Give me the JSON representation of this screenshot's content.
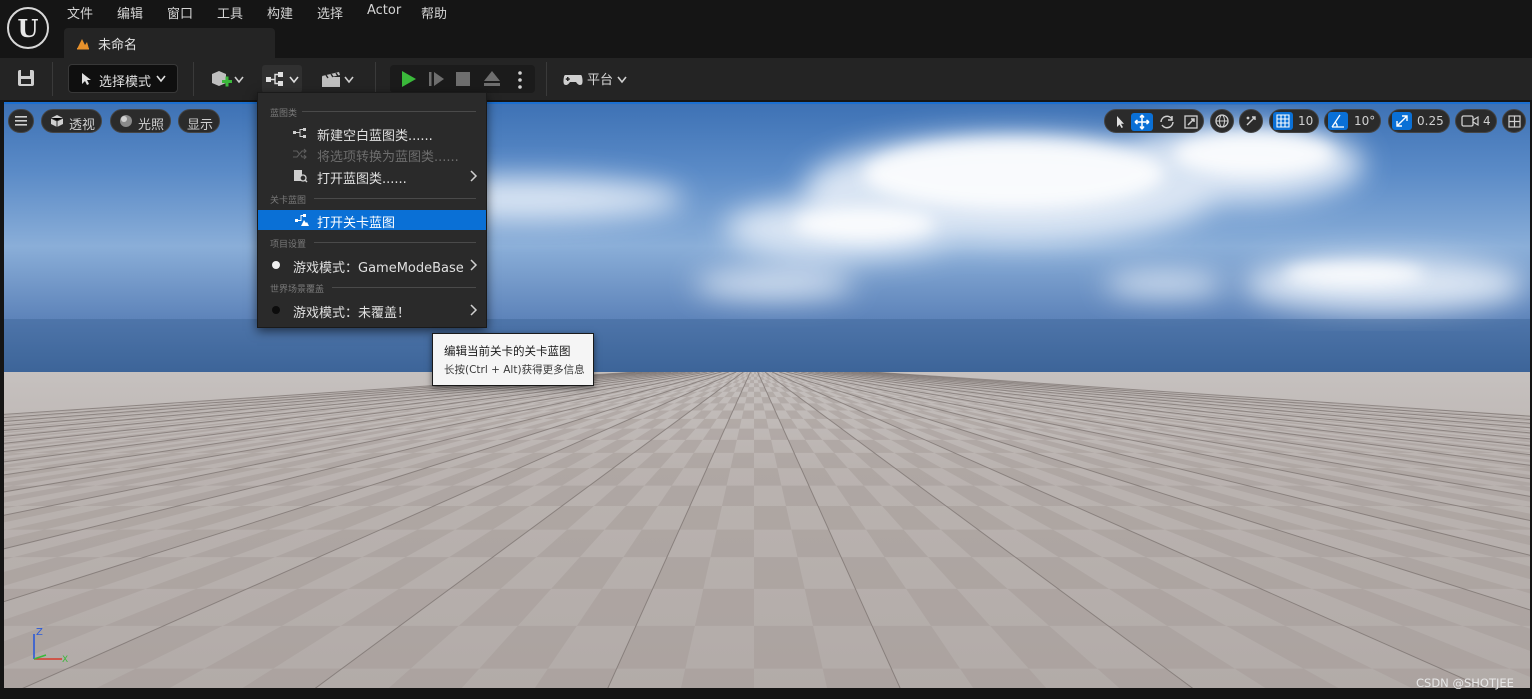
{
  "menubar": {
    "items": [
      {
        "label": "文件"
      },
      {
        "label": "编辑"
      },
      {
        "label": "窗口"
      },
      {
        "label": "工具"
      },
      {
        "label": "构建"
      },
      {
        "label": "选择"
      },
      {
        "label": "Actor"
      },
      {
        "label": "帮助"
      }
    ]
  },
  "tab": {
    "title": "未命名",
    "icon": "level-icon"
  },
  "toolbar": {
    "mode_label": "选择模式",
    "platform_label": "平台",
    "icons": [
      "save-icon",
      "add-actor-icon",
      "blueprint-icon",
      "cinematics-icon",
      "play-icon",
      "step-icon",
      "stop-icon",
      "eject-icon",
      "more-icon",
      "platform-icon"
    ],
    "play_color": "#3bb93b"
  },
  "viewport": {
    "perspective_label": "透视",
    "lighting_label": "光照",
    "show_label": "显示",
    "grid_snap": "10",
    "rotation_snap": "10°",
    "scale_snap": "0.25",
    "camera_speed": "4",
    "axis_z": "Z",
    "axis_x": "X",
    "accent_color": "#0a70d6"
  },
  "dropdown": {
    "section_blueprint": "蓝图类",
    "new_blueprint": "新建空白蓝图类......",
    "convert_selection": "将选项转换为蓝图类......",
    "open_blueprint": "打开蓝图类......",
    "section_level_blueprint": "关卡蓝图",
    "open_level_blueprint": "打开关卡蓝图",
    "section_project_settings": "项目设置",
    "game_mode_project": "游戏模式：GameModeBase",
    "section_world_override": "世界场景覆盖",
    "game_mode_world": "游戏模式：未覆盖！"
  },
  "tooltip": {
    "title": "编辑当前关卡的关卡蓝图",
    "hint": "长按(Ctrl + Alt)获得更多信息"
  },
  "watermark": "CSDN @SHOTJEE"
}
